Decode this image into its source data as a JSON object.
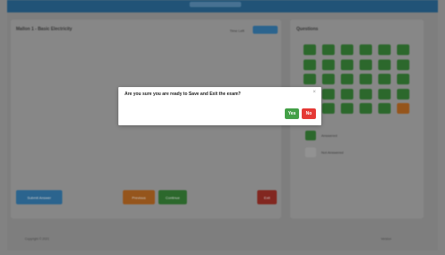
{
  "header": {
    "brand": ""
  },
  "exam": {
    "title": "Mallon 1 - Basic Electricity",
    "timer_label": "Time Left",
    "timer_value": ""
  },
  "questions_panel": {
    "title": "Questions",
    "answered_label": "Answered",
    "unanswered_label": "Not Answered",
    "grid": [
      {
        "n": "1",
        "state": "answered"
      },
      {
        "n": "2",
        "state": "answered"
      },
      {
        "n": "3",
        "state": "answered"
      },
      {
        "n": "4",
        "state": "answered"
      },
      {
        "n": "5",
        "state": "answered"
      },
      {
        "n": "6",
        "state": "answered"
      },
      {
        "n": "7",
        "state": "answered"
      },
      {
        "n": "8",
        "state": "answered"
      },
      {
        "n": "9",
        "state": "answered"
      },
      {
        "n": "10",
        "state": "answered"
      },
      {
        "n": "11",
        "state": "answered"
      },
      {
        "n": "12",
        "state": "answered"
      },
      {
        "n": "13",
        "state": "answered"
      },
      {
        "n": "14",
        "state": "answered"
      },
      {
        "n": "15",
        "state": "answered"
      },
      {
        "n": "16",
        "state": "answered"
      },
      {
        "n": "17",
        "state": "answered"
      },
      {
        "n": "18",
        "state": "answered"
      },
      {
        "n": "19",
        "state": "answered"
      },
      {
        "n": "20",
        "state": "answered"
      },
      {
        "n": "21",
        "state": "answered"
      },
      {
        "n": "22",
        "state": "answered"
      },
      {
        "n": "23",
        "state": "answered"
      },
      {
        "n": "24",
        "state": "answered"
      },
      {
        "n": "25",
        "state": "answered"
      },
      {
        "n": "26",
        "state": "answered"
      },
      {
        "n": "27",
        "state": "answered"
      },
      {
        "n": "28",
        "state": "answered"
      },
      {
        "n": "29",
        "state": "answered"
      },
      {
        "n": "30",
        "state": "flagged"
      }
    ]
  },
  "buttons": {
    "submit": "Submit Answer",
    "previous": "Previous",
    "next": "Continue",
    "exit": "Exit"
  },
  "footer": {
    "left": "Copyright © 2021",
    "right": "Version"
  },
  "modal": {
    "message": "Are you sure you are ready to Save and Exit the exam?",
    "close": "×",
    "yes": "Yes",
    "no": "No"
  },
  "colors": {
    "yes": "#43a047",
    "no": "#e53935",
    "answered": "#2f6e2f",
    "flagged": "#9e5a1e"
  }
}
